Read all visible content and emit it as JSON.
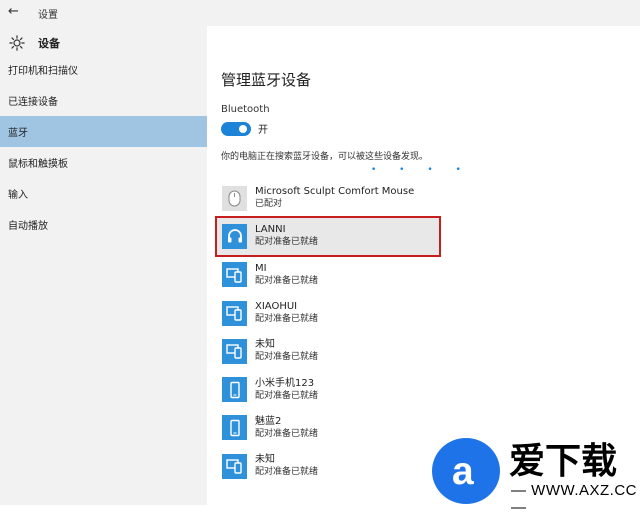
{
  "window": {
    "title": "设置",
    "back_icon": "arrow-left"
  },
  "sidebar": {
    "header": {
      "label": "设备",
      "icon": "gear-icon"
    },
    "items": [
      {
        "label": "打印机和扫描仪"
      },
      {
        "label": "已连接设备"
      },
      {
        "label": "蓝牙"
      },
      {
        "label": "鼠标和触摸板"
      },
      {
        "label": "输入"
      },
      {
        "label": "自动播放"
      }
    ]
  },
  "main": {
    "title": "管理蓝牙设备",
    "bluetooth_label": "Bluetooth",
    "toggle_state": "开",
    "status_text": "你的电脑正在搜索蓝牙设备，可以被这些设备发现。",
    "searching_dots": "• • • •",
    "devices": [
      {
        "name": "Microsoft Sculpt Comfort Mouse",
        "status": "已配对",
        "icon": "mouse-icon"
      },
      {
        "name": "LANNI",
        "status": "配对准备已就绪",
        "icon": "headphones-icon",
        "highlighted": true
      },
      {
        "name": "MI",
        "status": "配对准备已就绪",
        "icon": "device-icon"
      },
      {
        "name": "XIAOHUI",
        "status": "配对准备已就绪",
        "icon": "device-icon"
      },
      {
        "name": "未知",
        "status": "配对准备已就绪",
        "icon": "device-icon"
      },
      {
        "name": "小米手机123",
        "status": "配对准备已就绪",
        "icon": "phone-icon"
      },
      {
        "name": "魅蓝2",
        "status": "配对准备已就绪",
        "icon": "phone-icon"
      },
      {
        "name": "未知",
        "status": "配对准备已就绪",
        "icon": "device-icon"
      }
    ]
  },
  "watermark": {
    "main": "爱下载",
    "url": "— WWW.AXZ.CC —",
    "letter": "a"
  },
  "colors": {
    "accent": "#1b84d8",
    "sidebar_active": "#9fc5e2",
    "highlight_border": "#c61d1d"
  }
}
